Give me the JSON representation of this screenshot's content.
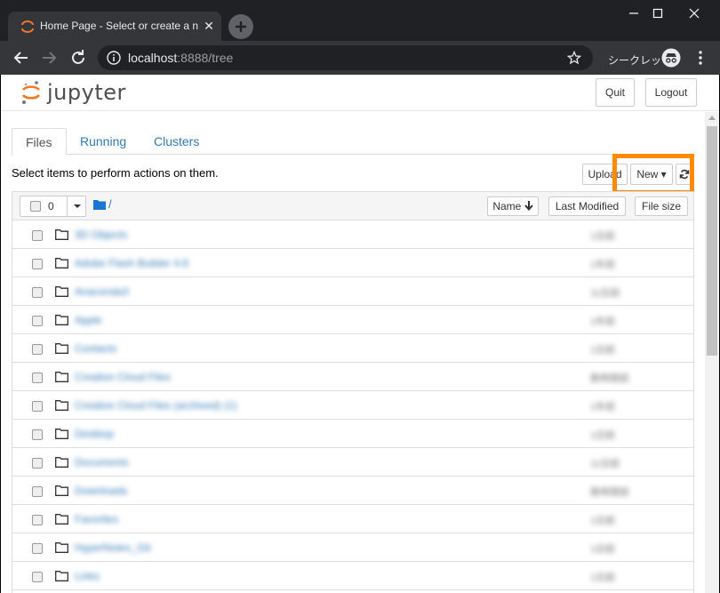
{
  "browser": {
    "tab_title": "Home Page - Select or create a n",
    "new_tab_label": "+",
    "close_label": "✕",
    "url_host": "localhost",
    "url_rest": ":8888/tree",
    "incognito_label": "シークレット"
  },
  "header": {
    "logo_text": "jupyter",
    "quit_label": "Quit",
    "logout_label": "Logout"
  },
  "tabs": [
    {
      "label": "Files",
      "active": true
    },
    {
      "label": "Running",
      "active": false
    },
    {
      "label": "Clusters",
      "active": false
    }
  ],
  "instructions": "Select items to perform actions on them.",
  "actions": {
    "upload_label": "Upload",
    "new_label": "New ▾"
  },
  "list_header": {
    "selected_count": "0",
    "path": "/",
    "sort_name_label": "Name",
    "sort_modified_label": "Last Modified",
    "sort_size_label": "File size"
  },
  "colors": {
    "highlight": "#ff8a00",
    "link": "#337ab7",
    "folder": "#1976d2"
  },
  "rows": [
    {
      "name": "3D Objects",
      "modified": "1日前"
    },
    {
      "name": "Adobe Flash Builder 4.6",
      "modified": "1年前"
    },
    {
      "name": "Anaconda3",
      "modified": "11日前"
    },
    {
      "name": "Apple",
      "modified": "1年前"
    },
    {
      "name": "Contacts",
      "modified": "1日前"
    },
    {
      "name": "Creative Cloud Files",
      "modified": "数時間前"
    },
    {
      "name": "Creative Cloud Files (archived) (1)",
      "modified": "1年前"
    },
    {
      "name": "Desktop",
      "modified": "1日前"
    },
    {
      "name": "Documents",
      "modified": "11日前"
    },
    {
      "name": "Downloads",
      "modified": "数時間前"
    },
    {
      "name": "Favorites",
      "modified": "1日前"
    },
    {
      "name": "HyperNotes_Git",
      "modified": "1日前"
    },
    {
      "name": "Links",
      "modified": "1日前"
    }
  ]
}
